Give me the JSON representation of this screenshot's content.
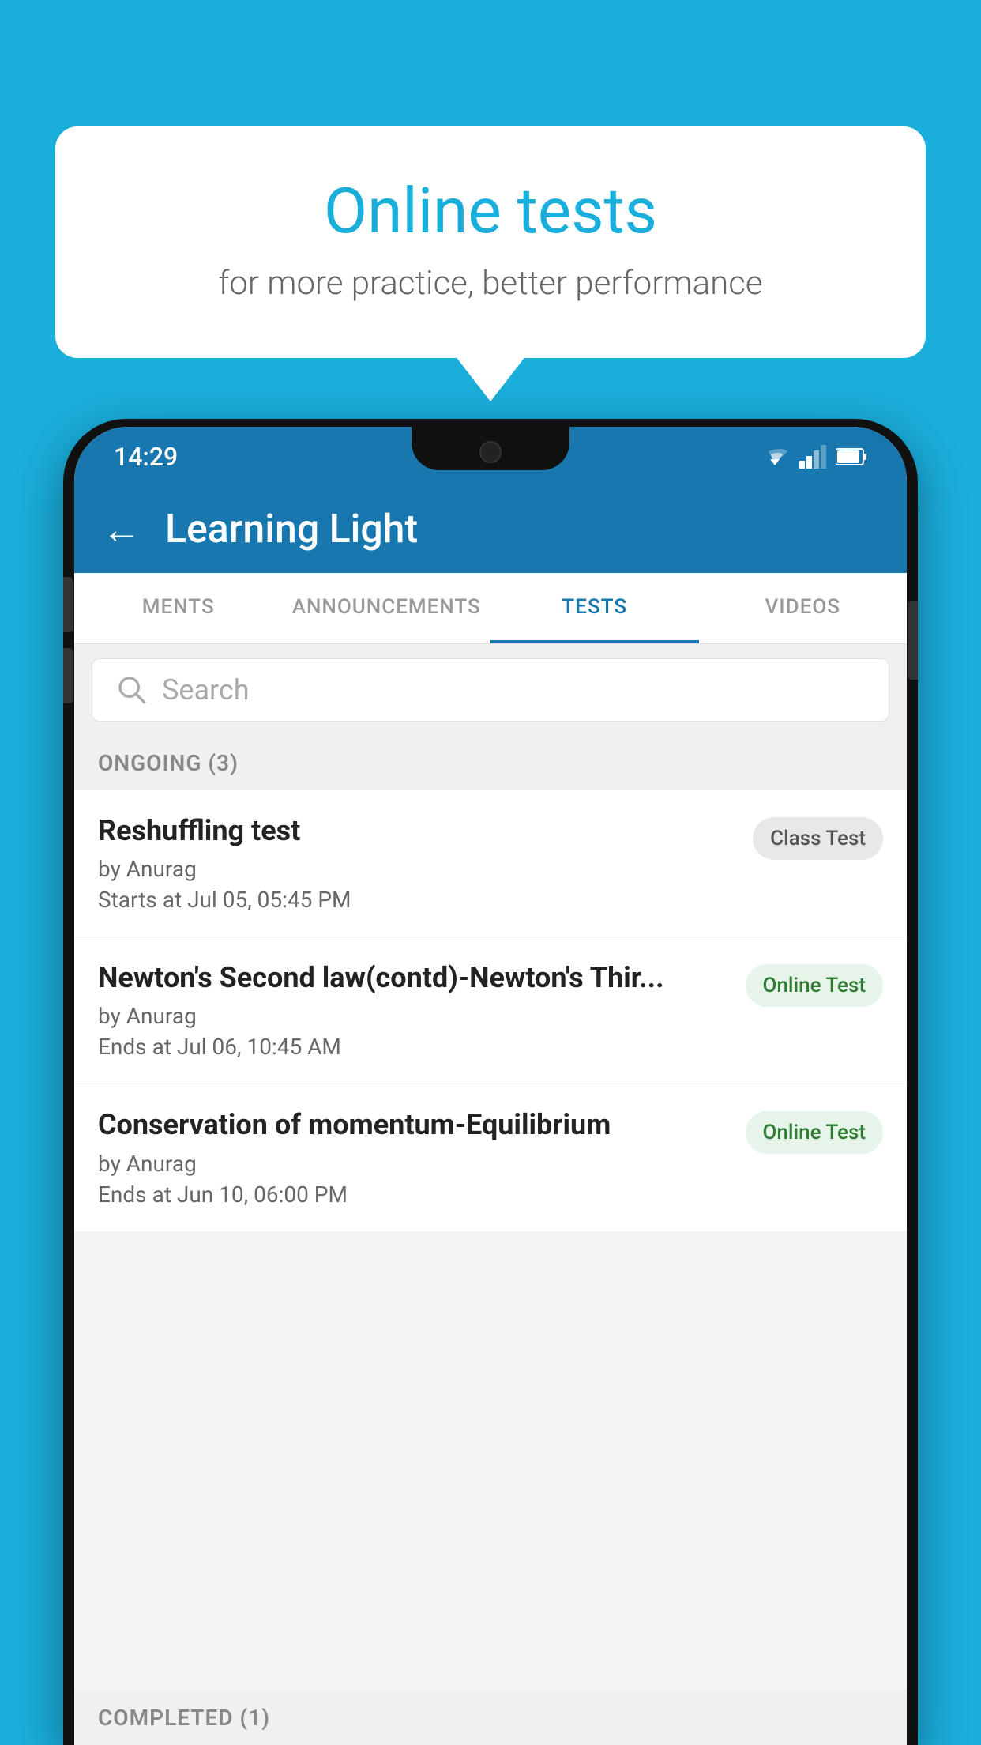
{
  "background_color": "#1AAEDB",
  "speech_bubble": {
    "title": "Online tests",
    "subtitle": "for more practice, better performance"
  },
  "phone": {
    "status_bar": {
      "time": "14:29"
    },
    "app_bar": {
      "title": "Learning Light",
      "back_label": "←"
    },
    "tabs": [
      {
        "label": "MENTS",
        "active": false
      },
      {
        "label": "ANNOUNCEMENTS",
        "active": false
      },
      {
        "label": "TESTS",
        "active": true
      },
      {
        "label": "VIDEOS",
        "active": false
      }
    ],
    "search": {
      "placeholder": "Search"
    },
    "ongoing_section": {
      "label": "ONGOING (3)"
    },
    "tests": [
      {
        "name": "Reshuffling test",
        "author": "by Anurag",
        "date": "Starts at  Jul 05, 05:45 PM",
        "badge": "Class Test",
        "badge_type": "class"
      },
      {
        "name": "Newton's Second law(contd)-Newton's Thir...",
        "author": "by Anurag",
        "date": "Ends at  Jul 06, 10:45 AM",
        "badge": "Online Test",
        "badge_type": "online"
      },
      {
        "name": "Conservation of momentum-Equilibrium",
        "author": "by Anurag",
        "date": "Ends at  Jun 10, 06:00 PM",
        "badge": "Online Test",
        "badge_type": "online"
      }
    ],
    "completed_section": {
      "label": "COMPLETED (1)"
    }
  }
}
